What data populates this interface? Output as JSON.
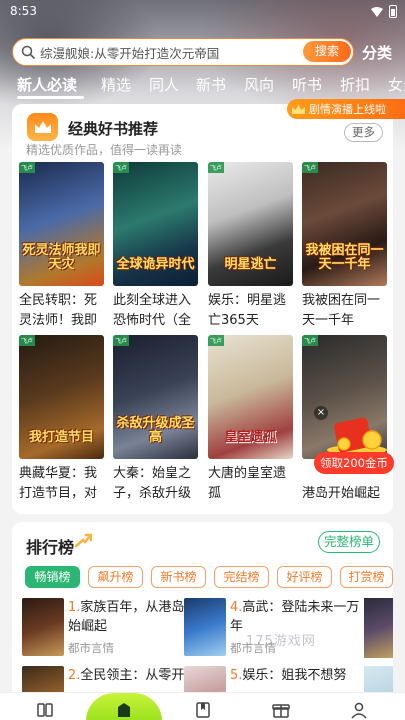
{
  "status": {
    "time": "8:53"
  },
  "search": {
    "query": "综漫舰娘:从零开始打造次元帝国",
    "button": "搜索",
    "category_link": "分类"
  },
  "tabs": [
    "新人必读",
    "精选",
    "同人",
    "新书",
    "风向",
    "听书",
    "折扣",
    "女生"
  ],
  "promo": {
    "label": "剧情演播上线啦"
  },
  "recommend": {
    "title": "经典好书推荐",
    "subtitle": "精选优质作品，值得一读再读",
    "more": "更多",
    "books": [
      {
        "name": "全民转职：死灵法师！我即",
        "cover_text": "死灵法师我即天灾"
      },
      {
        "name": "此刻全球进入恐怖时代（全",
        "cover_text": "全球诡异时代"
      },
      {
        "name": "娱乐：明星逃亡365天",
        "cover_text": "明星逃亡"
      },
      {
        "name": "我被困在同一天一千年",
        "cover_text": "我被困在同一天一千年"
      },
      {
        "name": "典藏华夏：我打造节目，对",
        "cover_text": "我打造节目"
      },
      {
        "name": "大秦：始皇之子，杀敌升级",
        "cover_text": "杀敌升级成圣高"
      },
      {
        "name": "大唐的皇室遗孤",
        "cover_text": "皇室遗孤"
      },
      {
        "name": "领取200金币",
        "cover_text": ""
      }
    ],
    "book8_second_line": "港岛开始崛起",
    "coin_widget": {
      "label": "领取200金币",
      "close": "×"
    }
  },
  "ranking": {
    "title": "排行榜",
    "full_button": "完整榜单",
    "chips": [
      "畅销榜",
      "飙升榜",
      "新书榜",
      "完结榜",
      "好评榜",
      "打赏榜"
    ],
    "items": [
      {
        "num": "1.",
        "name": "家族百年，从港岛开始崛起",
        "genre": "都市言情"
      },
      {
        "num": "4.",
        "name": "高武：登陆未来一万年",
        "genre": "都市言情"
      },
      {
        "num": "2.",
        "name": "全民领主：从零开",
        "genre": ""
      },
      {
        "num": "5.",
        "name": "娱乐：姐我不想努",
        "genre": ""
      }
    ]
  },
  "watermark": "175游戏网",
  "colors": {
    "accent": "#ff6a1a",
    "green": "#2bb673",
    "nav_center": "#9be21e"
  }
}
